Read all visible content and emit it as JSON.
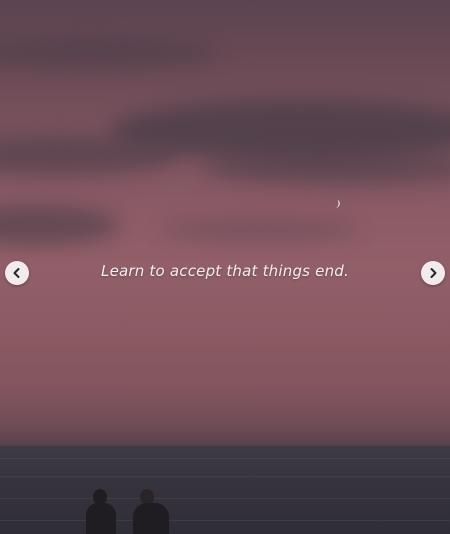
{
  "post": {
    "caption": "Learn to accept that things end."
  },
  "navigation": {
    "prev_icon": "chevron-left-icon",
    "next_icon": "chevron-right-icon"
  },
  "colors": {
    "sky_top": "#5b4450",
    "sky_mid": "#925f69",
    "sea": "#37343e",
    "caption_text": "#f2eef0",
    "nav_button_bg": "#ffffff"
  }
}
